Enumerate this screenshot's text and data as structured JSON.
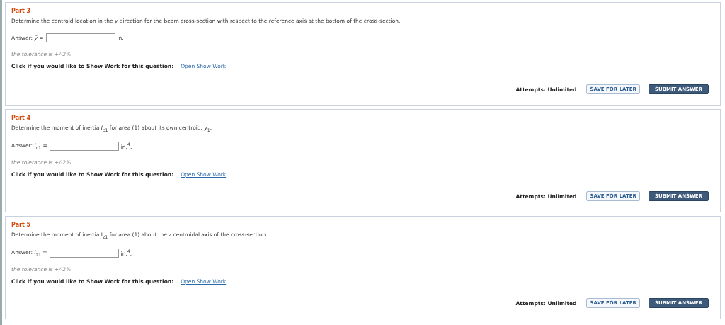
{
  "parts": [
    {
      "title": "Part 3",
      "question": "Determine the centroid location in the *y* direction for the beam cross-section with respect to the reference axis at the bottom of the cross-section.",
      "answer_label": "Answer: *ȳ* =",
      "unit": "in.",
      "tolerance": "the tolerance is +/-2%",
      "show_work_prompt": "Click if you would like to Show Work for this question:",
      "show_work_link": "Open Show Work",
      "attempts": "Attempts: Unlimited",
      "save_button": "SAVE FOR LATER",
      "submit_button": "SUBMIT ANSWER"
    },
    {
      "title": "Part 4",
      "question": "Determine the moment of inertia *I*$_{c1}$ for area (1) about its own centroid, *y*$_{1}$.",
      "answer_label": "Answer: *I*$_{c1}$ =",
      "unit": "in.$^{4}$.",
      "tolerance": "the tolerance is +/-2%",
      "show_work_prompt": "Click if you would like to Show Work for this question:",
      "show_work_link": "Open Show Work",
      "attempts": "Attempts: Unlimited",
      "save_button": "SAVE FOR LATER",
      "submit_button": "SUBMIT ANSWER"
    },
    {
      "title": "Part 5",
      "question": "Determine the moment of inertia I$_{z1}$ for area (1) about the *z* centroidal axis of the cross-section.",
      "answer_label": "Answer: *I*$_{z1}$ =",
      "unit": "in.$^{4}$.",
      "tolerance": "the tolerance is +/-2%",
      "show_work_prompt": "Click if you would like to Show Work for this question:",
      "show_work_link": "Open Show Work",
      "attempts": "Attempts: Unlimited",
      "save_button": "SAVE FOR LATER",
      "submit_button": "SUBMIT ANSWER"
    }
  ]
}
